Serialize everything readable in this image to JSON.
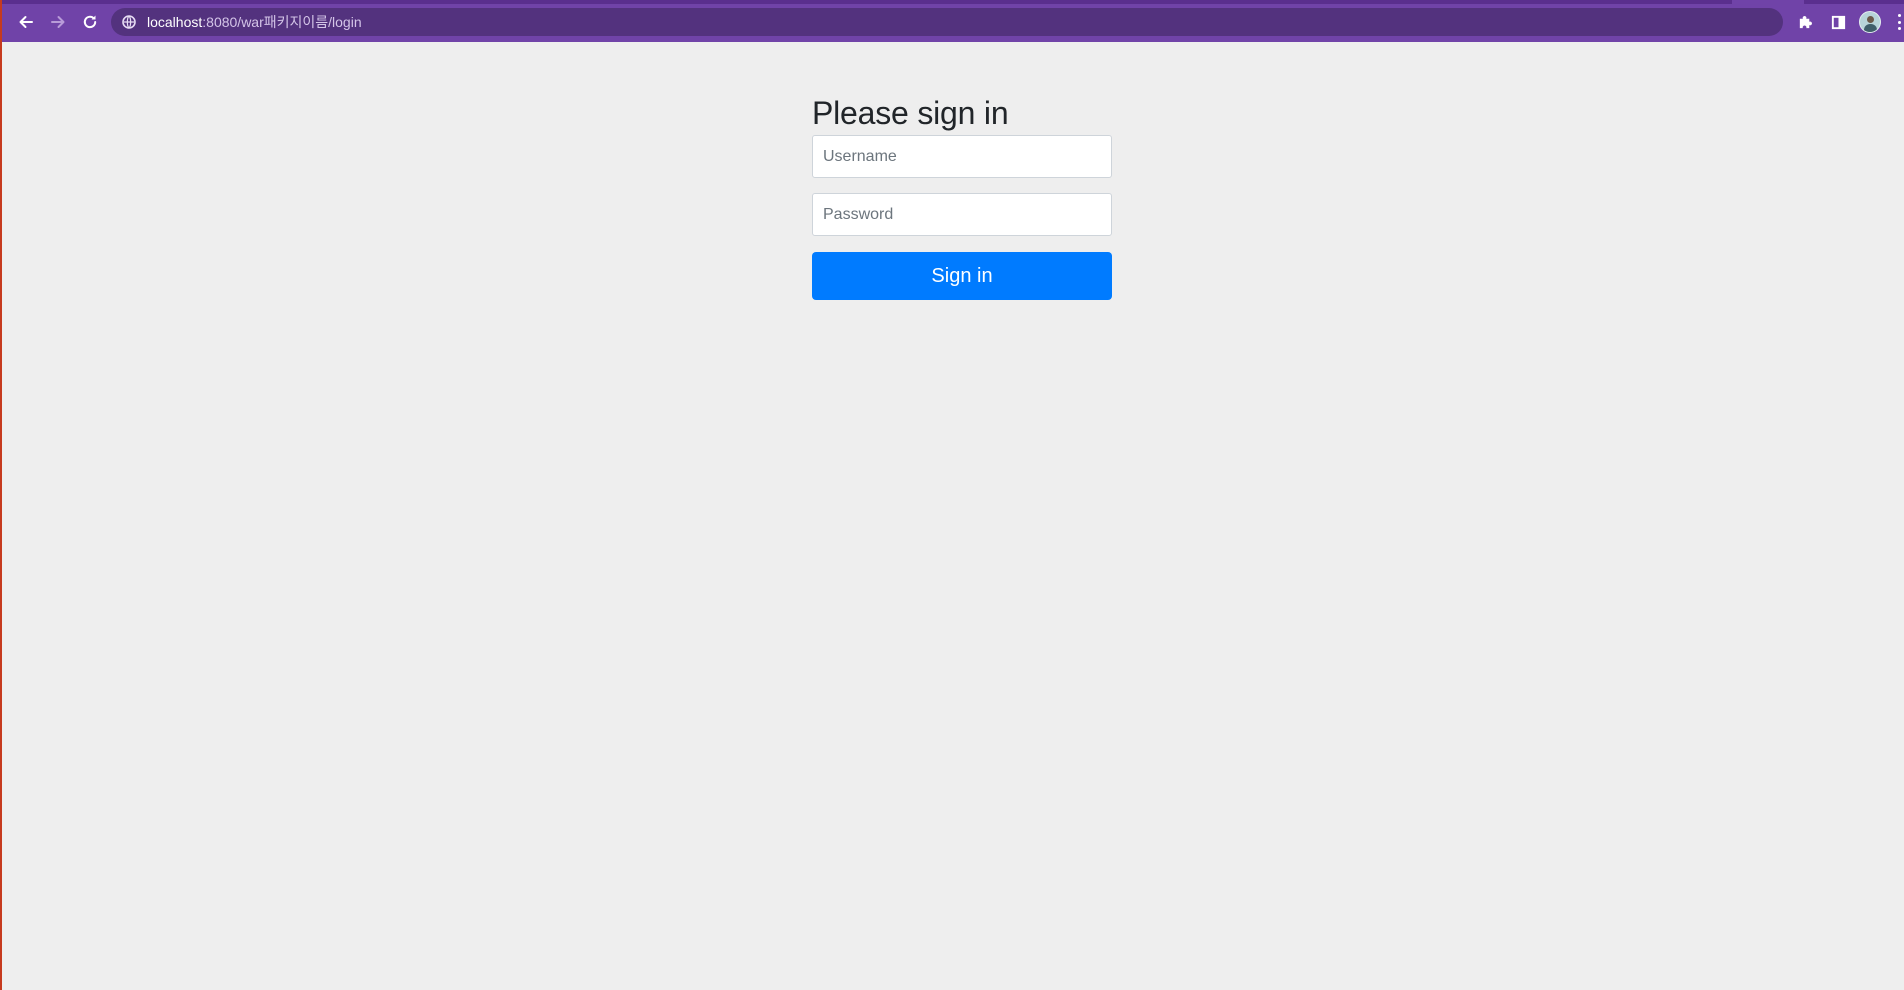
{
  "browser": {
    "url_host": "localhost",
    "url_rest": ":8080/war패키지이름/login",
    "icons": {
      "back": "back-arrow-icon",
      "forward": "forward-arrow-icon",
      "reload": "reload-icon",
      "site_info": "site-info-icon",
      "extensions": "puzzle-piece-icon",
      "side_panel": "side-panel-icon",
      "profile": "avatar",
      "menu": "kebab-menu-icon"
    },
    "theme_color": "#7043a8"
  },
  "login": {
    "heading": "Please sign in",
    "username_placeholder": "Username",
    "username_value": "",
    "password_placeholder": "Password",
    "password_value": "",
    "submit_label": "Sign in",
    "submit_color": "#007bff"
  }
}
